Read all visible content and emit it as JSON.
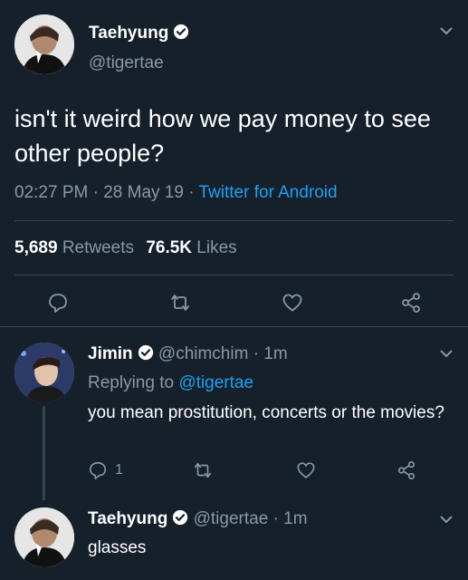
{
  "main_tweet": {
    "display_name": "Taehyung",
    "handle": "@tigertae",
    "text": "isn't it weird how we pay money to see other people?",
    "time": "02:27 PM",
    "date": "28 May 19",
    "separator": "·",
    "source": "Twitter for Android",
    "retweets_count": "5,689",
    "retweets_label": "Retweets",
    "likes_count": "76.5K",
    "likes_label": "Likes"
  },
  "reply_1": {
    "display_name": "Jimin",
    "handle": "@chimchim",
    "time": "· 1m",
    "replying_prefix": "Replying to",
    "replying_handle": "@tigertae",
    "text": "you mean prostitution, concerts or the movies?",
    "reply_count": "1"
  },
  "reply_2": {
    "display_name": "Taehyung",
    "handle": "@tigertae",
    "time": "· 1m",
    "text": "glasses"
  },
  "colors": {
    "background": "#15202b",
    "accent": "#1da1f2",
    "muted": "#8899a6",
    "divider": "#38444d"
  }
}
